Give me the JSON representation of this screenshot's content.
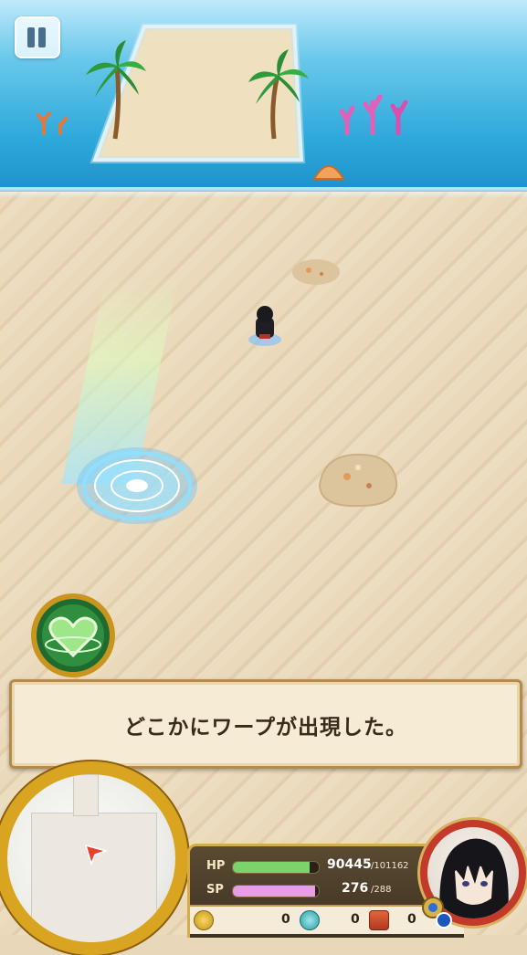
{
  "hud": {
    "pause_icon": "pause-icon",
    "skill_icon": "heart-buff-icon"
  },
  "message": {
    "text": "どこかにワープが出現した。"
  },
  "status": {
    "hp_label": "HP",
    "hp_current": "90445",
    "hp_max": "/101162",
    "hp_fraction": 0.894,
    "sp_label": "SP",
    "sp_current": "276",
    "sp_max": "/288",
    "sp_fraction": 0.958,
    "gold": "0",
    "crystal": "0",
    "chest": "0",
    "gold_icon": "gold-coin-icon",
    "crystal_icon": "soul-crystal-icon",
    "chest_icon": "treasure-chest-icon"
  },
  "colors": {
    "hp": "#7bd36a",
    "sp": "#e79ee6",
    "frame_gold": "#d6ac4a"
  }
}
